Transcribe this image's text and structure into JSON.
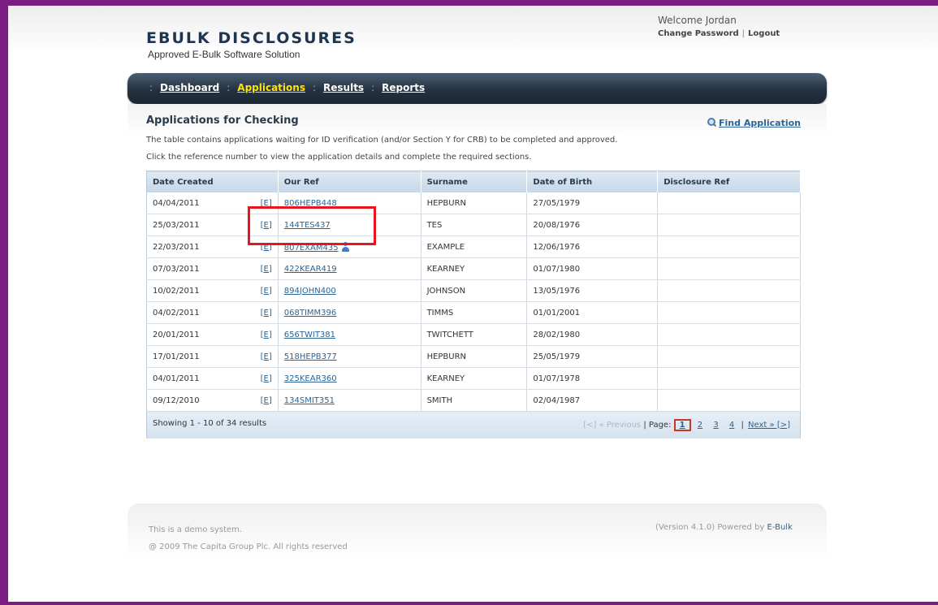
{
  "header": {
    "logo_title": "EBULK DISCLOSURES",
    "logo_subtitle": "Approved E-Bulk Software Solution",
    "welcome": "Welcome Jordan",
    "change_password": "Change Password",
    "logout": "Logout"
  },
  "nav": {
    "items": [
      {
        "label": "Dashboard"
      },
      {
        "label": "Applications"
      },
      {
        "label": "Results"
      },
      {
        "label": "Reports"
      }
    ],
    "active": "Applications"
  },
  "main": {
    "title": "Applications for Checking",
    "find_application": "Find Application",
    "description1": "The table contains applications waiting for ID verification (and/or Section Y for CRB) to be completed and approved.",
    "description2": "Click the reference number to view the application details and complete the required sections."
  },
  "table": {
    "columns": [
      "Date Created",
      "Our Ref",
      "Surname",
      "Date of Birth",
      "Disclosure Ref"
    ],
    "edit_label": "[E]",
    "rows": [
      {
        "date": "04/04/2011",
        "ref": "806HEPB448",
        "surname": "HEPBURN",
        "dob": "27/05/1979",
        "disclosure": ""
      },
      {
        "date": "25/03/2011",
        "ref": "144TES437",
        "surname": "TES",
        "dob": "20/08/1976",
        "disclosure": ""
      },
      {
        "date": "22/03/2011",
        "ref": "807EXAM435",
        "surname": "EXAMPLE",
        "dob": "12/06/1976",
        "disclosure": ""
      },
      {
        "date": "07/03/2011",
        "ref": "422KEAR419",
        "surname": "KEARNEY",
        "dob": "01/07/1980",
        "disclosure": ""
      },
      {
        "date": "10/02/2011",
        "ref": "894JOHN400",
        "surname": "JOHNSON",
        "dob": "13/05/1976",
        "disclosure": ""
      },
      {
        "date": "04/02/2011",
        "ref": "068TIMM396",
        "surname": "TIMMS",
        "dob": "01/01/2001",
        "disclosure": ""
      },
      {
        "date": "20/01/2011",
        "ref": "656TWIT381",
        "surname": "TWITCHETT",
        "dob": "28/02/1980",
        "disclosure": ""
      },
      {
        "date": "17/01/2011",
        "ref": "518HEPB377",
        "surname": "HEPBURN",
        "dob": "25/05/1979",
        "disclosure": ""
      },
      {
        "date": "04/01/2011",
        "ref": "325KEAR360",
        "surname": "KEARNEY",
        "dob": "01/07/1978",
        "disclosure": ""
      },
      {
        "date": "09/12/2010",
        "ref": "134SMIT351",
        "surname": "SMITH",
        "dob": "02/04/1987",
        "disclosure": ""
      }
    ],
    "showing": "Showing 1 - 10 of 34 results",
    "pager": {
      "previous": "[<] « Previous",
      "page_label": "| Page:",
      "pages": [
        "1",
        "2",
        "3",
        "4"
      ],
      "current": "1",
      "next": "Next » [>]"
    }
  },
  "footer": {
    "demo": "This is a demo system.",
    "copyright": "@ 2009 The Capita Group Plc. All rights reserved",
    "version": "(Version 4.1.0) Powered by",
    "powered_link": "E-Bulk"
  }
}
